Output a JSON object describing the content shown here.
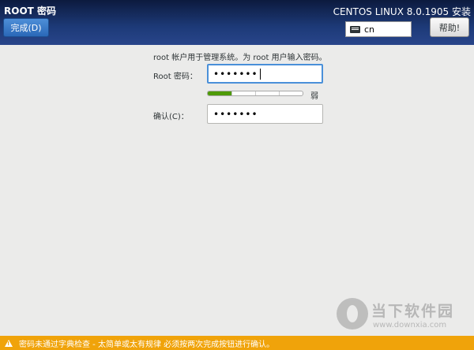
{
  "header": {
    "page_title": "ROOT 密码",
    "done_label": "完成(D)",
    "product_title": "CENTOS LINUX 8.0.1905 安装",
    "keyboard_layout": "cn",
    "help_label": "帮助!"
  },
  "form": {
    "description": "root 帐户用于管理系统。为 root 用户输入密码。",
    "root_password_label": "Root 密码：",
    "root_password_value": "•••••••",
    "strength_label": "弱",
    "strength_fraction": 0.25,
    "confirm_label": "确认(C)：",
    "confirm_value": "•••••••"
  },
  "watermark": {
    "name": "当下软件园",
    "url": "www.downxia.com"
  },
  "warning": {
    "text": "密码未通过字典检查 - 太简单或太有规律 必须按两次完成按钮进行确认。"
  }
}
